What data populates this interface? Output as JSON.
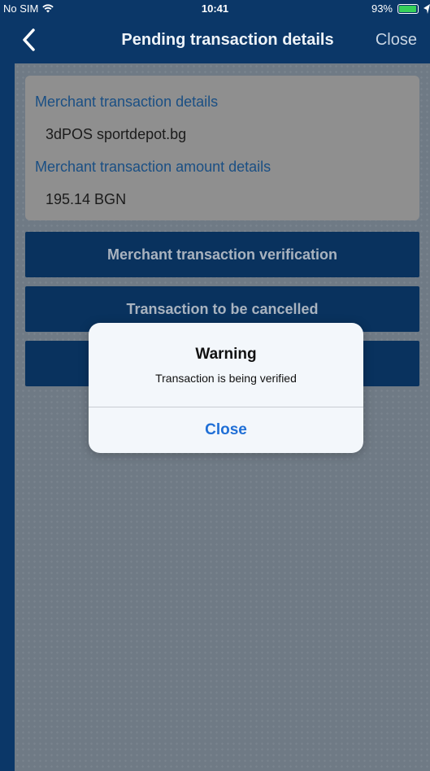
{
  "status_bar": {
    "carrier": "No SIM",
    "time": "10:41",
    "battery": "93%",
    "battery_level": 0.93,
    "battery_color": "#36d05a"
  },
  "nav": {
    "back_icon": "chevron-left-icon",
    "title": "Pending transaction details",
    "close_label": "Close"
  },
  "details": {
    "merchant_label": "Merchant transaction details",
    "merchant_value": "3dPOS sportdepot.bg",
    "amount_label": "Merchant transaction amount details",
    "amount_value": "195.14 BGN"
  },
  "actions": {
    "verify_label": "Merchant transaction verification",
    "cancel_label": "Transaction to be cancelled"
  },
  "alert": {
    "title": "Warning",
    "message": "Transaction is being verified",
    "close_label": "Close"
  },
  "colors": {
    "brand": "#0b3768",
    "alert_button": "#1f6fd6"
  }
}
